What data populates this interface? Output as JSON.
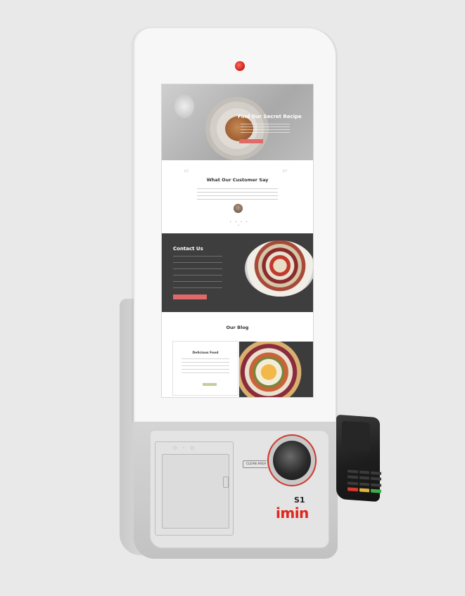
{
  "kiosk": {
    "model": "S1",
    "brand": "imin",
    "scanner_label": "CLEAN AREA"
  },
  "screen": {
    "hero_title": "Find Our Secret Recipe",
    "quote_title": "What Our Customer Say",
    "contact_title": "Contact Us",
    "blog_title": "Our Blog",
    "blog_card_title": "Delicious Food"
  },
  "colors": {
    "brand_red": "#e0261b",
    "button_coral": "#e06a6a",
    "contact_bg": "#3e3e3e"
  }
}
